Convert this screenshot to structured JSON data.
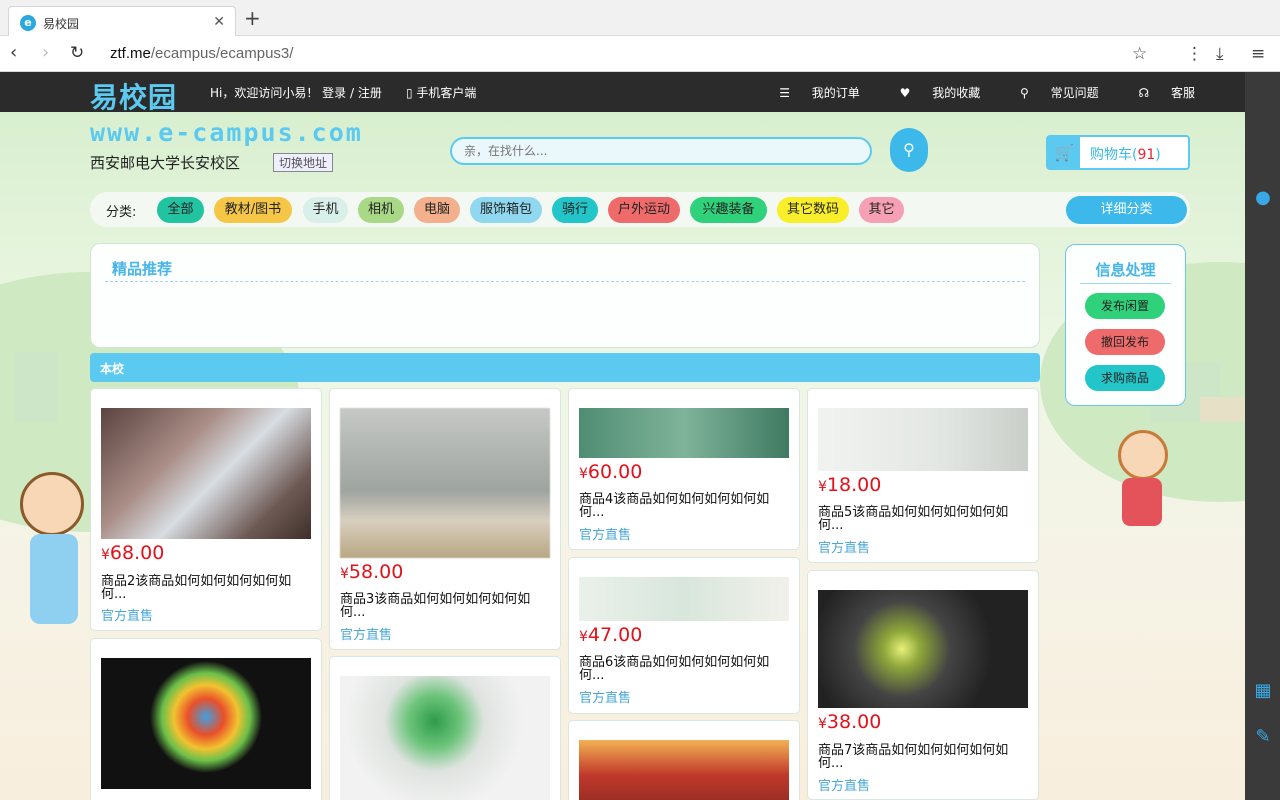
{
  "browser": {
    "tab_title": "易校园",
    "tab_favicon": "e",
    "url_host": "ztf.me",
    "url_path": "/ecampus/ecampus3/"
  },
  "header": {
    "logo": "易校园",
    "greeting": "Hi，欢迎访问小易！ 登录 / 注册",
    "mobile_client": "手机客户端",
    "my_orders": "我的订单",
    "my_favorites": "我的收藏",
    "faq": "常见问题",
    "service": "客服"
  },
  "banner": {
    "domain": "www.e-campus.com",
    "school": "西安邮电大学长安校区",
    "switch_address": "切换地址",
    "search_placeholder": "亲，在找什么...",
    "cart_label": "购物车(",
    "cart_count": "91",
    "cart_close": ")"
  },
  "categories": {
    "label": "分类:",
    "items": [
      {
        "label": "全部",
        "color": "#21c3a0"
      },
      {
        "label": "教材/图书",
        "color": "#f6c746"
      },
      {
        "label": "手机",
        "color": "#d9f0ea"
      },
      {
        "label": "相机",
        "color": "#a9d886"
      },
      {
        "label": "电脑",
        "color": "#f4b08c"
      },
      {
        "label": "服饰箱包",
        "color": "#8fd8ef"
      },
      {
        "label": "骑行",
        "color": "#22c6c9"
      },
      {
        "label": "户外运动",
        "color": "#ef6b6b"
      },
      {
        "label": "兴趣装备",
        "color": "#2fd27a"
      },
      {
        "label": "其它数码",
        "color": "#f9ee2a"
      },
      {
        "label": "其它",
        "color": "#f5a0b4"
      }
    ],
    "detail": "详细分类"
  },
  "featured": {
    "title": "精品推荐"
  },
  "info_panel": {
    "title": "信息处理",
    "publish": "发布闲置",
    "withdraw": "撤回发布",
    "wanted": "求购商品"
  },
  "section": {
    "title": "本校"
  },
  "products": [
    {
      "price": "68.00",
      "desc": "商品2该商品如何如何如何如何如何...",
      "seller": "官方直售"
    },
    {
      "price": "58.00",
      "desc": "商品3该商品如何如何如何如何如何...",
      "seller": "官方直售"
    },
    {
      "price": "60.00",
      "desc": "商品4该商品如何如何如何如何如何...",
      "seller": "官方直售"
    },
    {
      "price": "18.00",
      "desc": "商品5该商品如何如何如何如何如何...",
      "seller": "官方直售"
    },
    {
      "price": "47.00",
      "desc": "商品6该商品如何如何如何如何如何...",
      "seller": "官方直售"
    },
    {
      "price": "38.00",
      "desc": "商品7该商品如何如何如何如何如何...",
      "seller": "官方直售"
    }
  ],
  "currency": "¥"
}
